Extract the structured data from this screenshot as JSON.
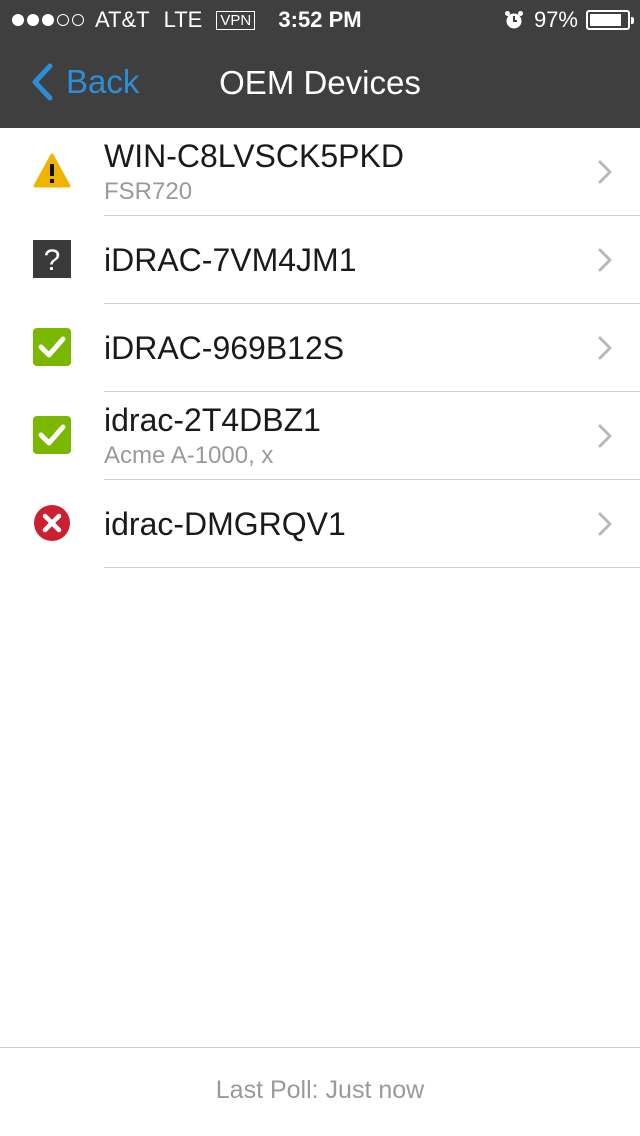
{
  "status_bar": {
    "carrier": "AT&T",
    "network": "LTE",
    "vpn": "VPN",
    "time": "3:52 PM",
    "battery_percent": "97%",
    "battery_level": 0.97,
    "signal_bars": 3,
    "signal_total": 5
  },
  "nav": {
    "back_label": "Back",
    "title": "OEM Devices"
  },
  "devices": [
    {
      "name": "WIN-C8LVSCK5PKD",
      "model": "FSR720",
      "status": "warning-icon"
    },
    {
      "name": "iDRAC-7VM4JM1",
      "model": "",
      "status": "unknown-icon"
    },
    {
      "name": "iDRAC-969B12S",
      "model": "",
      "status": "ok-icon"
    },
    {
      "name": "idrac-2T4DBZ1",
      "model": "Acme A-1000, x",
      "status": "ok-icon"
    },
    {
      "name": "idrac-DMGRQV1",
      "model": "",
      "status": "critical-icon"
    }
  ],
  "footer": {
    "last_poll": "Last Poll: Just now"
  },
  "colors": {
    "bar_bg": "#3f3f3f",
    "accent": "#2a8fd6",
    "warning": "#f0b400",
    "ok": "#7ab800",
    "critical": "#cc1f30",
    "unknown": "#3a3a3a"
  }
}
